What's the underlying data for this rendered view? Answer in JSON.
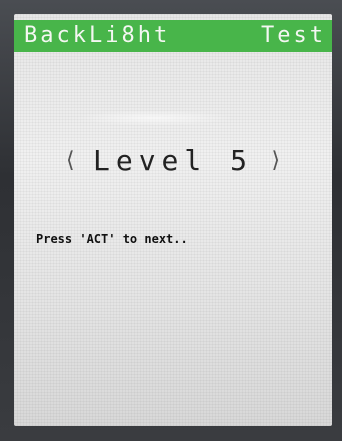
{
  "header": {
    "title_left": "BackLi8ht",
    "title_right": "Test"
  },
  "level": {
    "left_bracket": "⟨",
    "label": "Level 5",
    "right_bracket": "⟩"
  },
  "prompt": {
    "text": "Press 'ACT' to next.."
  },
  "colors": {
    "title_bar": "#48b54a",
    "screen": "#e6e6e6",
    "bezel": "#3c3f43"
  }
}
